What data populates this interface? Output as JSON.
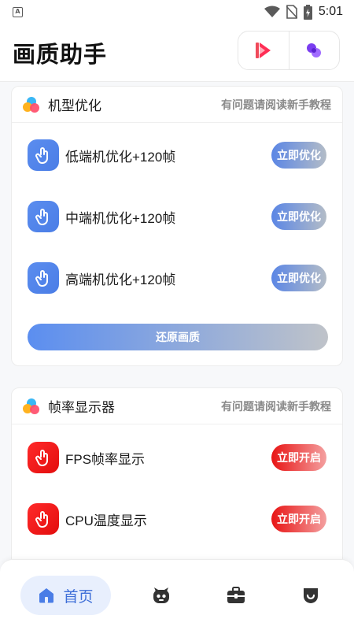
{
  "status_bar": {
    "time": "5:01",
    "icons": [
      "app-notification-icon",
      "wifi-icon",
      "no-sim-icon",
      "battery-charging-icon"
    ]
  },
  "header": {
    "title": "画质助手",
    "actions": [
      "video-play-icon",
      "link-bubbles-icon"
    ]
  },
  "cards": [
    {
      "title": "机型优化",
      "help_link": "有问题请阅读新手教程",
      "rows": [
        {
          "label": "低端机优化+120帧",
          "action": "立即优化"
        },
        {
          "label": "中端机优化+120帧",
          "action": "立即优化"
        },
        {
          "label": "高端机优化+120帧",
          "action": "立即优化"
        }
      ],
      "restore_label": "还原画质"
    },
    {
      "title": "帧率显示器",
      "help_link": "有问题请阅读新手教程",
      "rows": [
        {
          "label": "FPS帧率显示",
          "action": "立即开启"
        },
        {
          "label": "CPU温度显示",
          "action": "立即开启"
        }
      ]
    }
  ],
  "bottom_nav": {
    "items": [
      {
        "label": "首页",
        "icon": "home-icon",
        "active": true
      },
      {
        "label": "",
        "icon": "robot-icon"
      },
      {
        "label": "",
        "icon": "briefcase-icon"
      },
      {
        "label": "",
        "icon": "shield-icon"
      }
    ]
  },
  "colors": {
    "accent_blue": "#4a7de6",
    "accent_red": "#e81414",
    "nav_active_bg": "#e8effd"
  }
}
